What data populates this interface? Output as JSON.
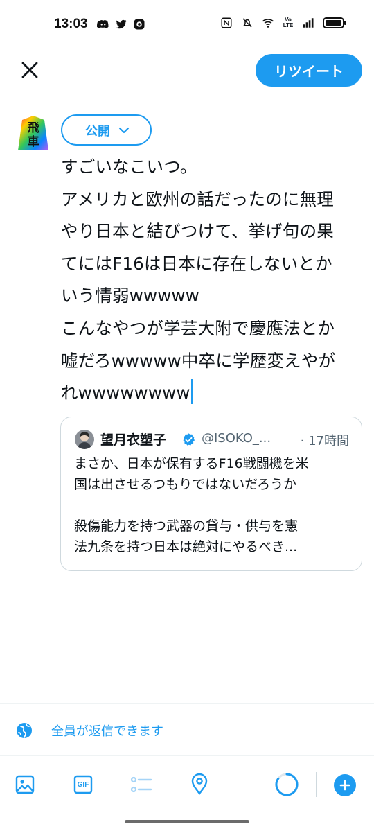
{
  "status_bar": {
    "time": "13:03",
    "app_icons": [
      "discord-icon",
      "twitter-icon",
      "app-icon"
    ],
    "system_icons": [
      "nfc-icon",
      "mute-icon",
      "wifi-icon",
      "volte-icon",
      "signal-icon",
      "battery-icon"
    ],
    "volte_text": "Vo LTE"
  },
  "header": {
    "close_icon": "close-icon",
    "retweet_label": "リツイート"
  },
  "compose": {
    "audience_label": "公開",
    "lines": [
      "すごいなこいつ。",
      "アメリカと欧州の話だったのに無理",
      "やり日本と結びつけて、挙げ句の果",
      "てにはF16は日本に存在しないとか",
      "いう情弱wwwww",
      "こんなやつが学芸大附で慶應法とか",
      "嘘だろwwwww中卒に学歴変えやが",
      "れwwwwwwww"
    ],
    "avatar_text": "飛車"
  },
  "quote": {
    "name": "望月衣塑子",
    "handle": "@ISOKO_...",
    "time": "· 17時間",
    "paragraph1": [
      "まさか、日本が保有するF16戦闘機を米",
      "国は出させるつもりではないだろうか"
    ],
    "paragraph2": [
      "殺傷能力を持つ武器の貸与・供与を憲",
      "法九条を持つ日本は絶対にやるべき..."
    ]
  },
  "reply_setting": {
    "label": "全員が返信できます"
  },
  "toolbar": {
    "items": [
      "image-icon",
      "gif-icon",
      "poll-icon",
      "location-icon"
    ],
    "gif_text": "GIF"
  },
  "colors": {
    "accent": "#1d9bf0",
    "text": "#0f1419",
    "secondary": "#536471",
    "border": "#cfd9de"
  }
}
